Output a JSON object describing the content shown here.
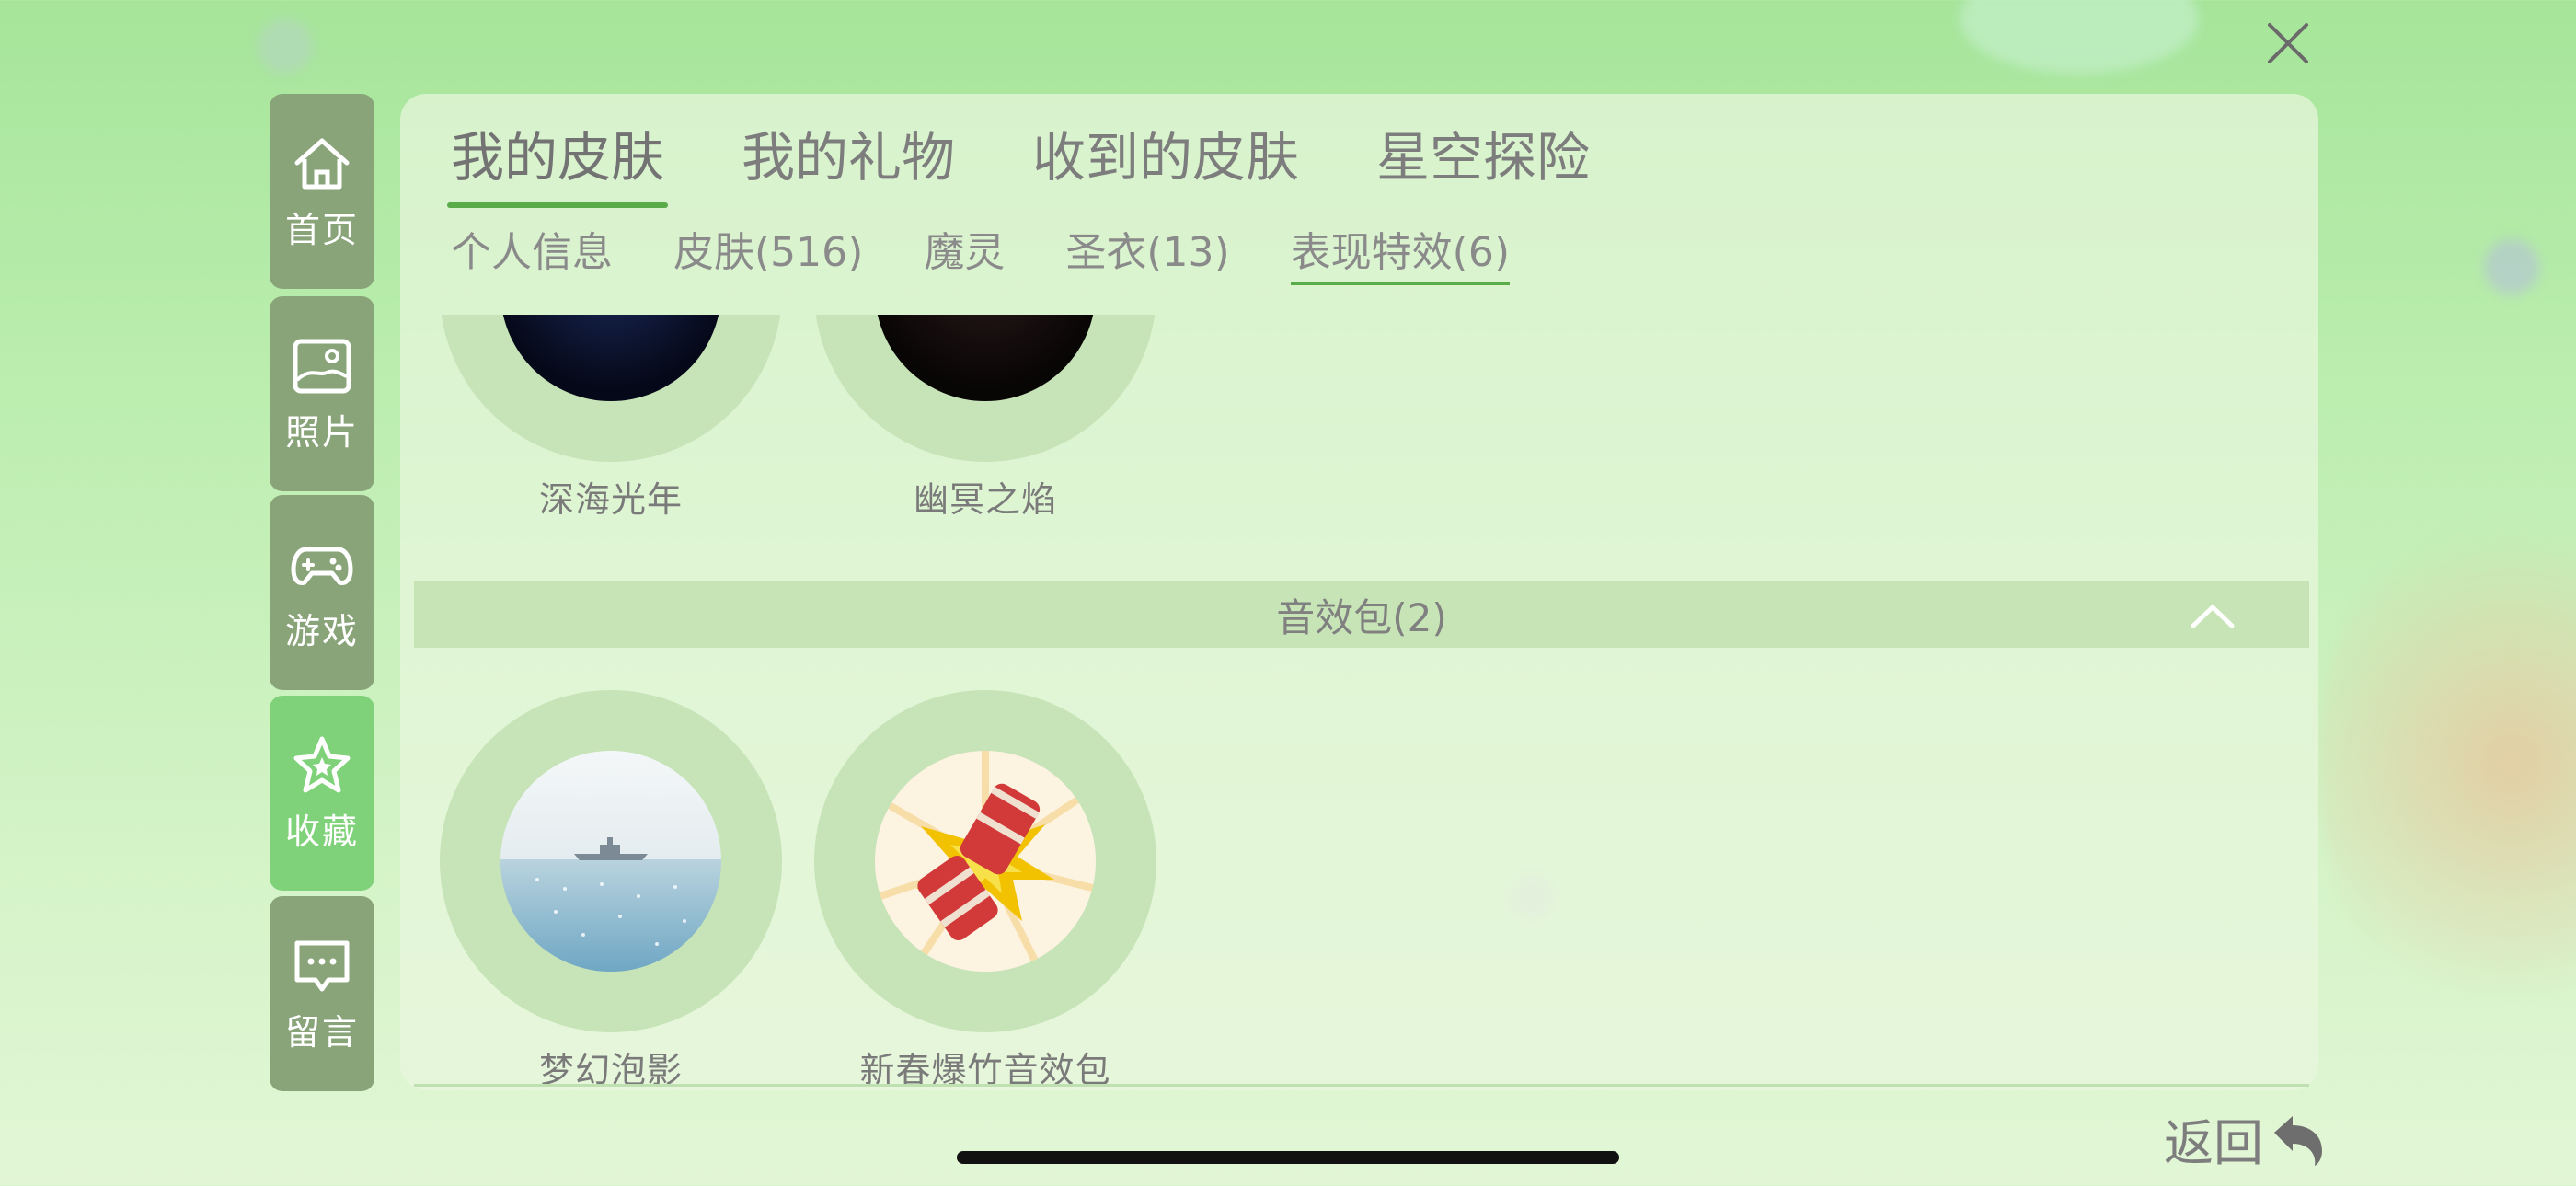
{
  "nav": [
    {
      "label": "首页",
      "icon": "home-icon"
    },
    {
      "label": "照片",
      "icon": "photo-icon"
    },
    {
      "label": "游戏",
      "icon": "gamepad-icon"
    },
    {
      "label": "收藏",
      "icon": "star-icon",
      "active": true
    },
    {
      "label": "留言",
      "icon": "message-icon"
    }
  ],
  "tabs": [
    "我的皮肤",
    "我的礼物",
    "收到的皮肤",
    "星空探险"
  ],
  "active_tab": "我的皮肤",
  "subtabs": [
    "个人信息",
    "皮肤(516)",
    "魔灵",
    "圣衣(13)",
    "表现特效(6)"
  ],
  "active_subtab": "表现特效(6)",
  "top_items": [
    "深海光年",
    "幽冥之焰"
  ],
  "section": {
    "title": "音效包(2)",
    "icon": "chevron-up-icon"
  },
  "sound_items": [
    "梦幻泡影",
    "新春爆竹音效包"
  ],
  "back_label": "返回",
  "colors": {
    "nav": "#8aa47a",
    "nav_active": "#7fd27a",
    "accent": "#5aab4a",
    "panel": "#e9f6de"
  }
}
